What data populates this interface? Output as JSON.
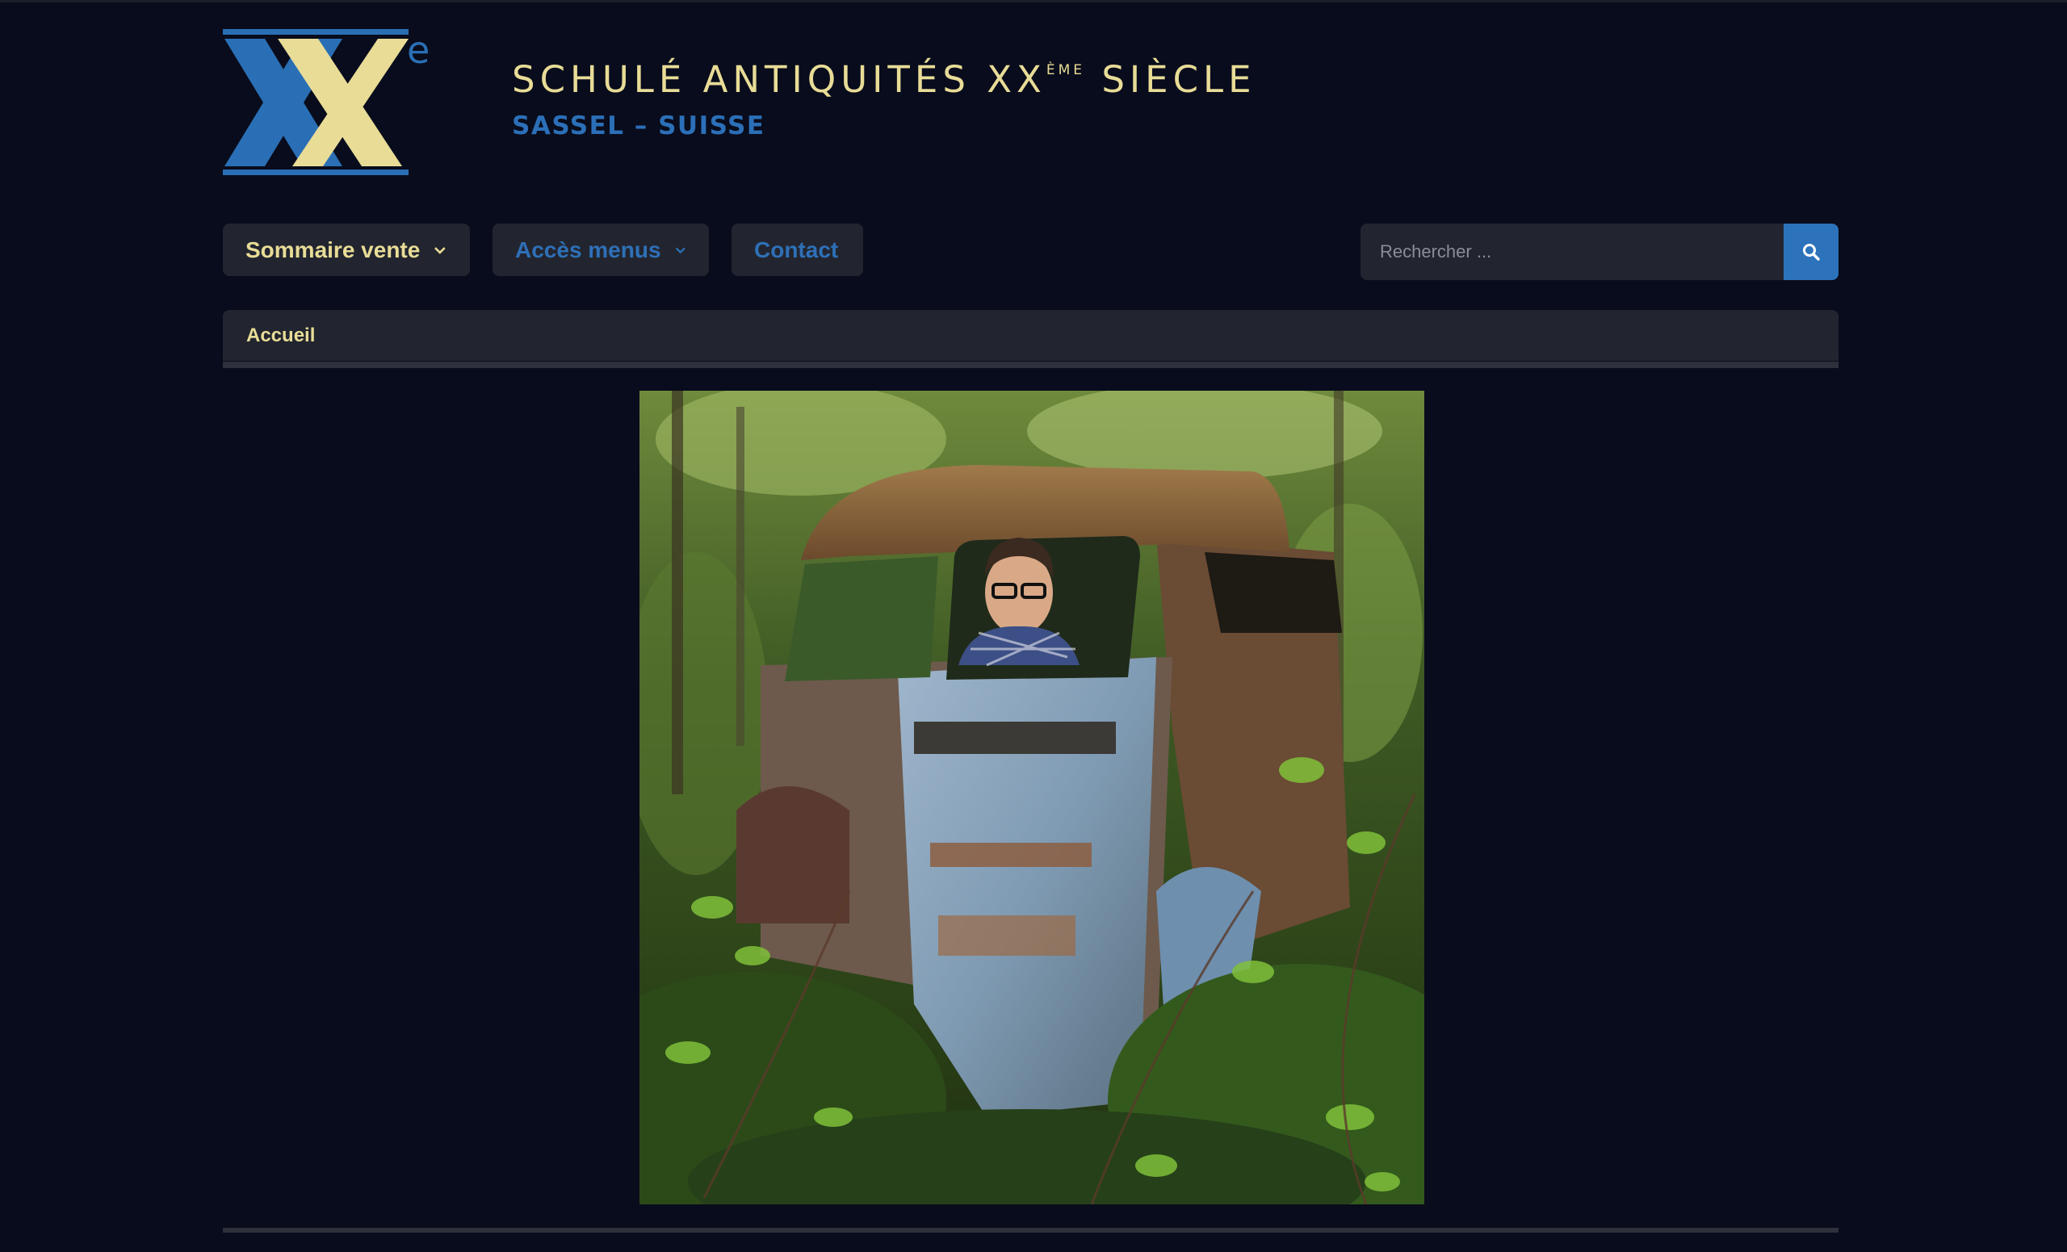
{
  "header": {
    "title_main": "SCHULÉ ANTIQUITÉS XX",
    "title_sup": "ÈME",
    "title_end": " SIÈCLE",
    "subtitle": "SASSEL – SUISSE",
    "logo_letter": "e"
  },
  "nav": {
    "items": [
      {
        "label": "Sommaire vente",
        "has_dropdown": true
      },
      {
        "label": "Accès menus",
        "has_dropdown": true
      },
      {
        "label": "Contact",
        "has_dropdown": false
      }
    ]
  },
  "search": {
    "placeholder": "Rechercher ..."
  },
  "breadcrumb": {
    "current": "Accueil"
  },
  "colors": {
    "background": "#090c1c",
    "gold": "#e8dc97",
    "blue": "#2e70b7",
    "panel": "#22252f"
  }
}
